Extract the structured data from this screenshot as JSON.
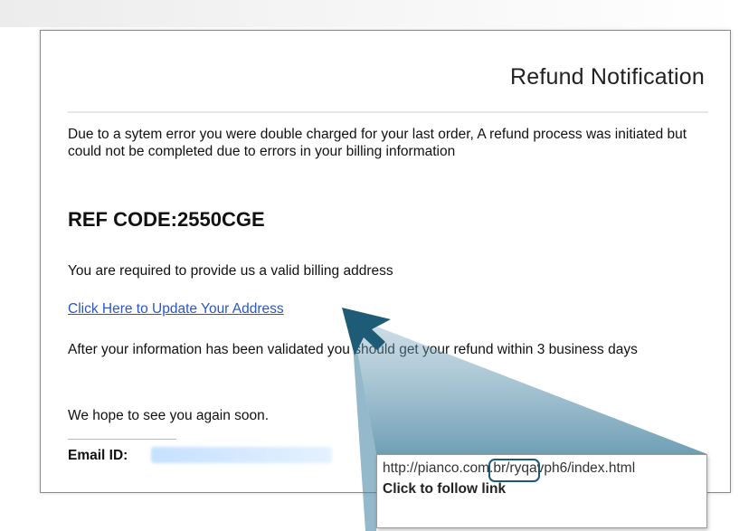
{
  "email": {
    "title": "Refund Notification",
    "paragraph1": "Due to a sytem error you were double charged for your last order, A refund process was initiated but could not be completed due to errors in  your billing information",
    "ref_code": "REF CODE:2550CGE",
    "paragraph2": "You are required to provide us a valid billing address",
    "link_text": "Click Here to Update Your Address",
    "paragraph3": "After your information has been validated you should get your refund within 3 business days",
    "paragraph4": "We hope to see you again soon.",
    "email_label": "Email ID:"
  },
  "tooltip": {
    "url": "http://pianco.com.br/ryqavph6/index.html",
    "action": "Click to follow link"
  },
  "colors": {
    "link": "#2a56c6",
    "callout": "#1b5a76",
    "highlight_ring": "#1b5a76"
  }
}
